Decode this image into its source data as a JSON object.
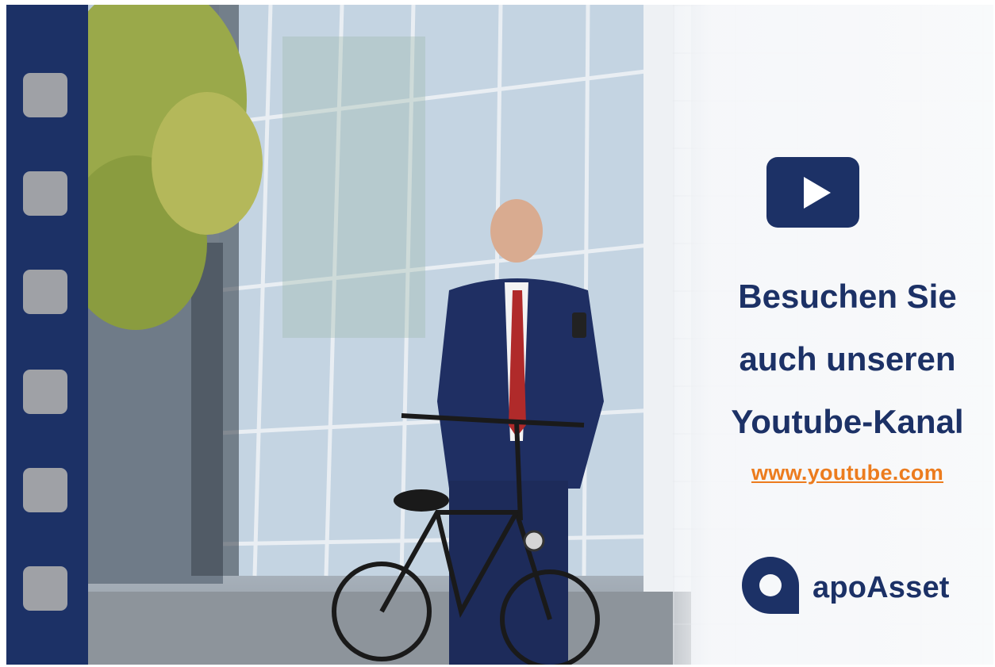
{
  "headline": {
    "line1": "Besuchen Sie",
    "line2": "auch unseren",
    "line3": "Youtube-Kanal"
  },
  "link": {
    "text": "www.youtube.com"
  },
  "brand": {
    "name": "apoAsset"
  },
  "icons": {
    "play": "play-icon",
    "logo": "apoasset-logo-icon"
  },
  "colors": {
    "navy": "#1c3166",
    "link_orange": "#ec7c1e",
    "perforation_gray": "#9fa1a6"
  }
}
